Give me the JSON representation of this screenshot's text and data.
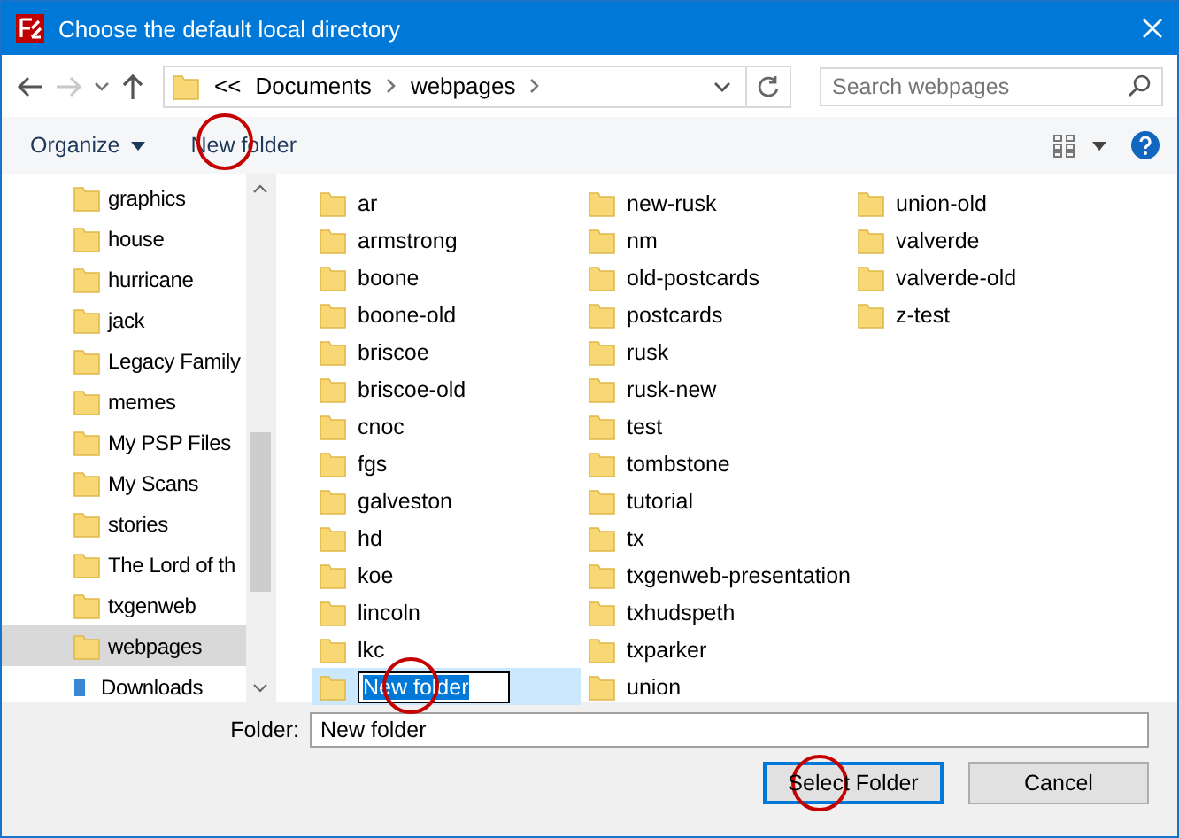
{
  "window": {
    "title": "Choose the default local directory"
  },
  "nav": {
    "back": {
      "disabled": false
    },
    "forward": {
      "disabled": true
    },
    "overflow": "<<",
    "breadcrumb": [
      "Documents",
      "webpages"
    ]
  },
  "search": {
    "placeholder": "Search webpages"
  },
  "toolbar": {
    "organize": "Organize",
    "new_folder": {
      "label": "New folder",
      "circled": true
    }
  },
  "sidebar": {
    "items": [
      {
        "label": "graphics",
        "kind": "folder",
        "selected": false
      },
      {
        "label": "house",
        "kind": "folder",
        "selected": false
      },
      {
        "label": "hurricane",
        "kind": "folder",
        "selected": false
      },
      {
        "label": "jack",
        "kind": "folder",
        "selected": false
      },
      {
        "label": "Legacy Family",
        "kind": "folder",
        "selected": false
      },
      {
        "label": "memes",
        "kind": "folder",
        "selected": false
      },
      {
        "label": "My PSP Files",
        "kind": "folder",
        "selected": false
      },
      {
        "label": "My Scans",
        "kind": "folder",
        "selected": false
      },
      {
        "label": "stories",
        "kind": "folder",
        "selected": false
      },
      {
        "label": "The Lord of th",
        "kind": "folder",
        "selected": false
      },
      {
        "label": "txgenweb",
        "kind": "folder",
        "selected": false
      },
      {
        "label": "webpages",
        "kind": "folder",
        "selected": true
      },
      {
        "label": "Downloads",
        "kind": "downloads",
        "selected": false
      }
    ]
  },
  "folders": [
    {
      "name": "ar",
      "kind": "folder",
      "selected": false
    },
    {
      "name": "armstrong",
      "kind": "folder",
      "selected": false
    },
    {
      "name": "boone",
      "kind": "folder",
      "selected": false
    },
    {
      "name": "boone-old",
      "kind": "folder",
      "selected": false
    },
    {
      "name": "briscoe",
      "kind": "folder",
      "selected": false
    },
    {
      "name": "briscoe-old",
      "kind": "folder",
      "selected": false
    },
    {
      "name": "cnoc",
      "kind": "folder",
      "selected": false
    },
    {
      "name": "fgs",
      "kind": "folder",
      "selected": false
    },
    {
      "name": "galveston",
      "kind": "folder",
      "selected": false
    },
    {
      "name": "hd",
      "kind": "folder",
      "selected": false
    },
    {
      "name": "koe",
      "kind": "folder",
      "selected": false
    },
    {
      "name": "lincoln",
      "kind": "folder",
      "selected": false
    },
    {
      "name": "lkc",
      "kind": "folder",
      "selected": false
    },
    {
      "name": "New folder",
      "kind": "rename",
      "selected": true,
      "circled": true
    },
    {
      "name": "new-rusk",
      "kind": "folder",
      "selected": false
    },
    {
      "name": "nm",
      "kind": "folder",
      "selected": false
    },
    {
      "name": "old-postcards",
      "kind": "folder",
      "selected": false
    },
    {
      "name": "postcards",
      "kind": "folder",
      "selected": false
    },
    {
      "name": "rusk",
      "kind": "folder",
      "selected": false
    },
    {
      "name": "rusk-new",
      "kind": "folder",
      "selected": false
    },
    {
      "name": "test",
      "kind": "folder",
      "selected": false
    },
    {
      "name": "tombstone",
      "kind": "folder",
      "selected": false
    },
    {
      "name": "tutorial",
      "kind": "folder",
      "selected": false
    },
    {
      "name": "tx",
      "kind": "folder",
      "selected": false
    },
    {
      "name": "txgenweb-presentation",
      "kind": "folder",
      "selected": false
    },
    {
      "name": "txhudspeth",
      "kind": "folder",
      "selected": false
    },
    {
      "name": "txparker",
      "kind": "folder",
      "selected": false
    },
    {
      "name": "union",
      "kind": "folder",
      "selected": false
    },
    {
      "name": "union-old",
      "kind": "folder",
      "selected": false
    },
    {
      "name": "valverde",
      "kind": "folder",
      "selected": false
    },
    {
      "name": "valverde-old",
      "kind": "folder",
      "selected": false
    },
    {
      "name": "z-test",
      "kind": "folder",
      "selected": false
    }
  ],
  "footer": {
    "folder_label": "Folder:",
    "folder_value": "New folder",
    "buttons": [
      {
        "label": "Select Folder",
        "default": true,
        "circled": true
      },
      {
        "label": "Cancel",
        "default": false,
        "circled": false
      }
    ]
  }
}
